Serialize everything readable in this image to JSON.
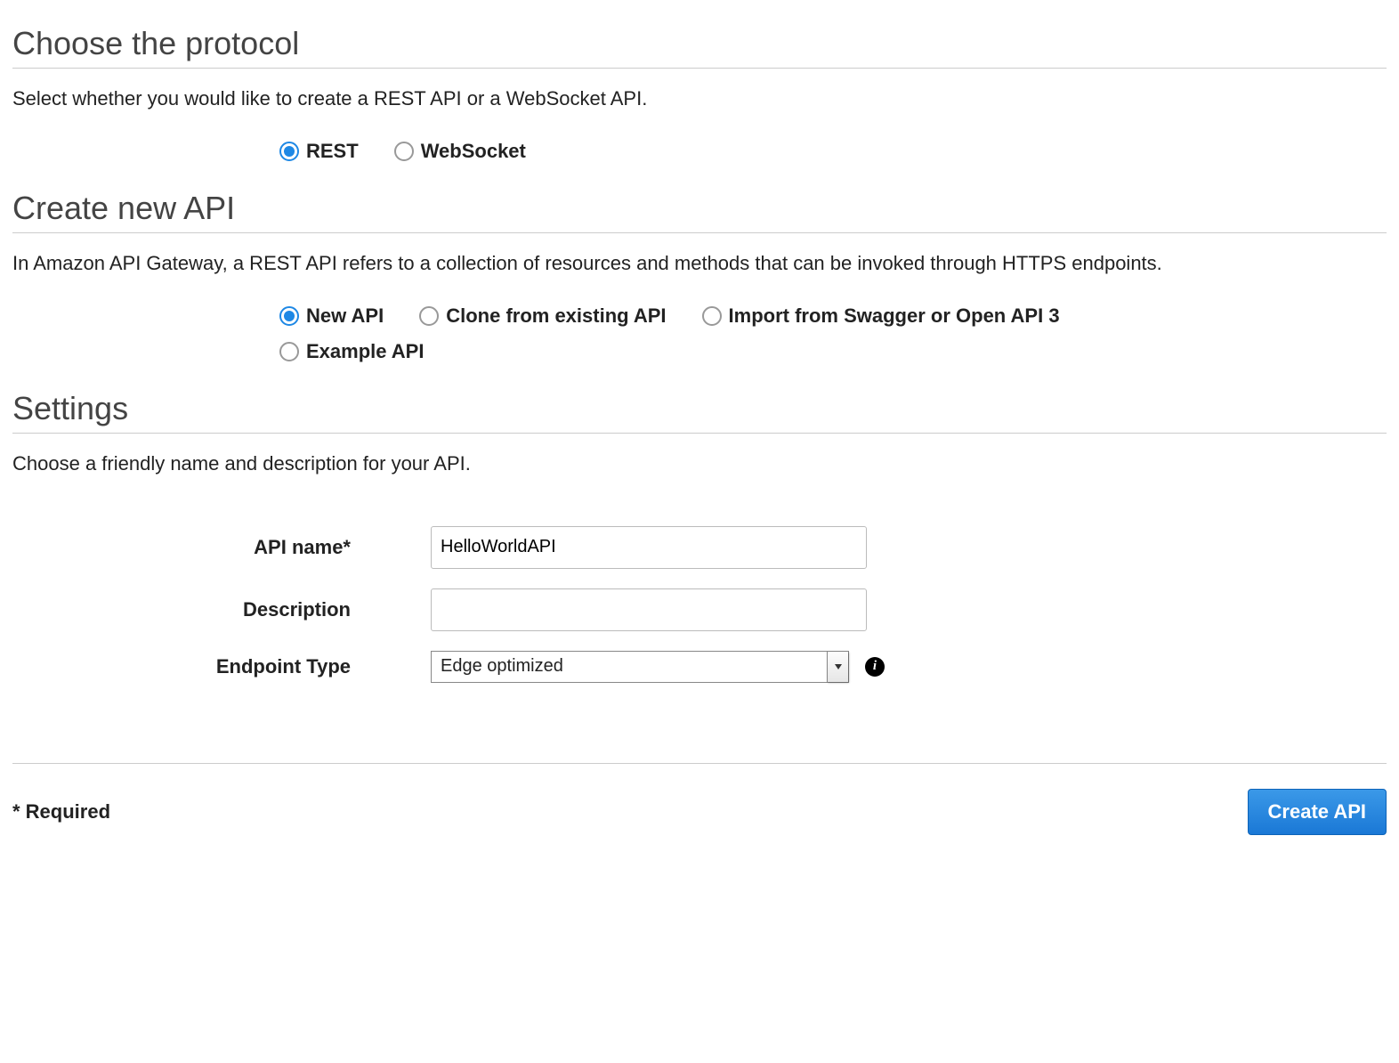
{
  "protocol_section": {
    "heading": "Choose the protocol",
    "description": "Select whether you would like to create a REST API or a WebSocket API.",
    "options": {
      "rest": "REST",
      "websocket": "WebSocket"
    },
    "selected": "rest"
  },
  "create_section": {
    "heading": "Create new API",
    "description": "In Amazon API Gateway, a REST API refers to a collection of resources and methods that can be invoked through HTTPS endpoints.",
    "options": {
      "new": "New API",
      "clone": "Clone from existing API",
      "import": "Import from Swagger or Open API 3",
      "example": "Example API"
    },
    "selected": "new"
  },
  "settings_section": {
    "heading": "Settings",
    "description": "Choose a friendly name and description for your API.",
    "labels": {
      "api_name": "API name*",
      "description": "Description",
      "endpoint_type": "Endpoint Type"
    },
    "values": {
      "api_name": "HelloWorldAPI",
      "description": "",
      "endpoint_type": "Edge optimized"
    }
  },
  "footer": {
    "required_note": "* Required",
    "create_button": "Create API"
  }
}
